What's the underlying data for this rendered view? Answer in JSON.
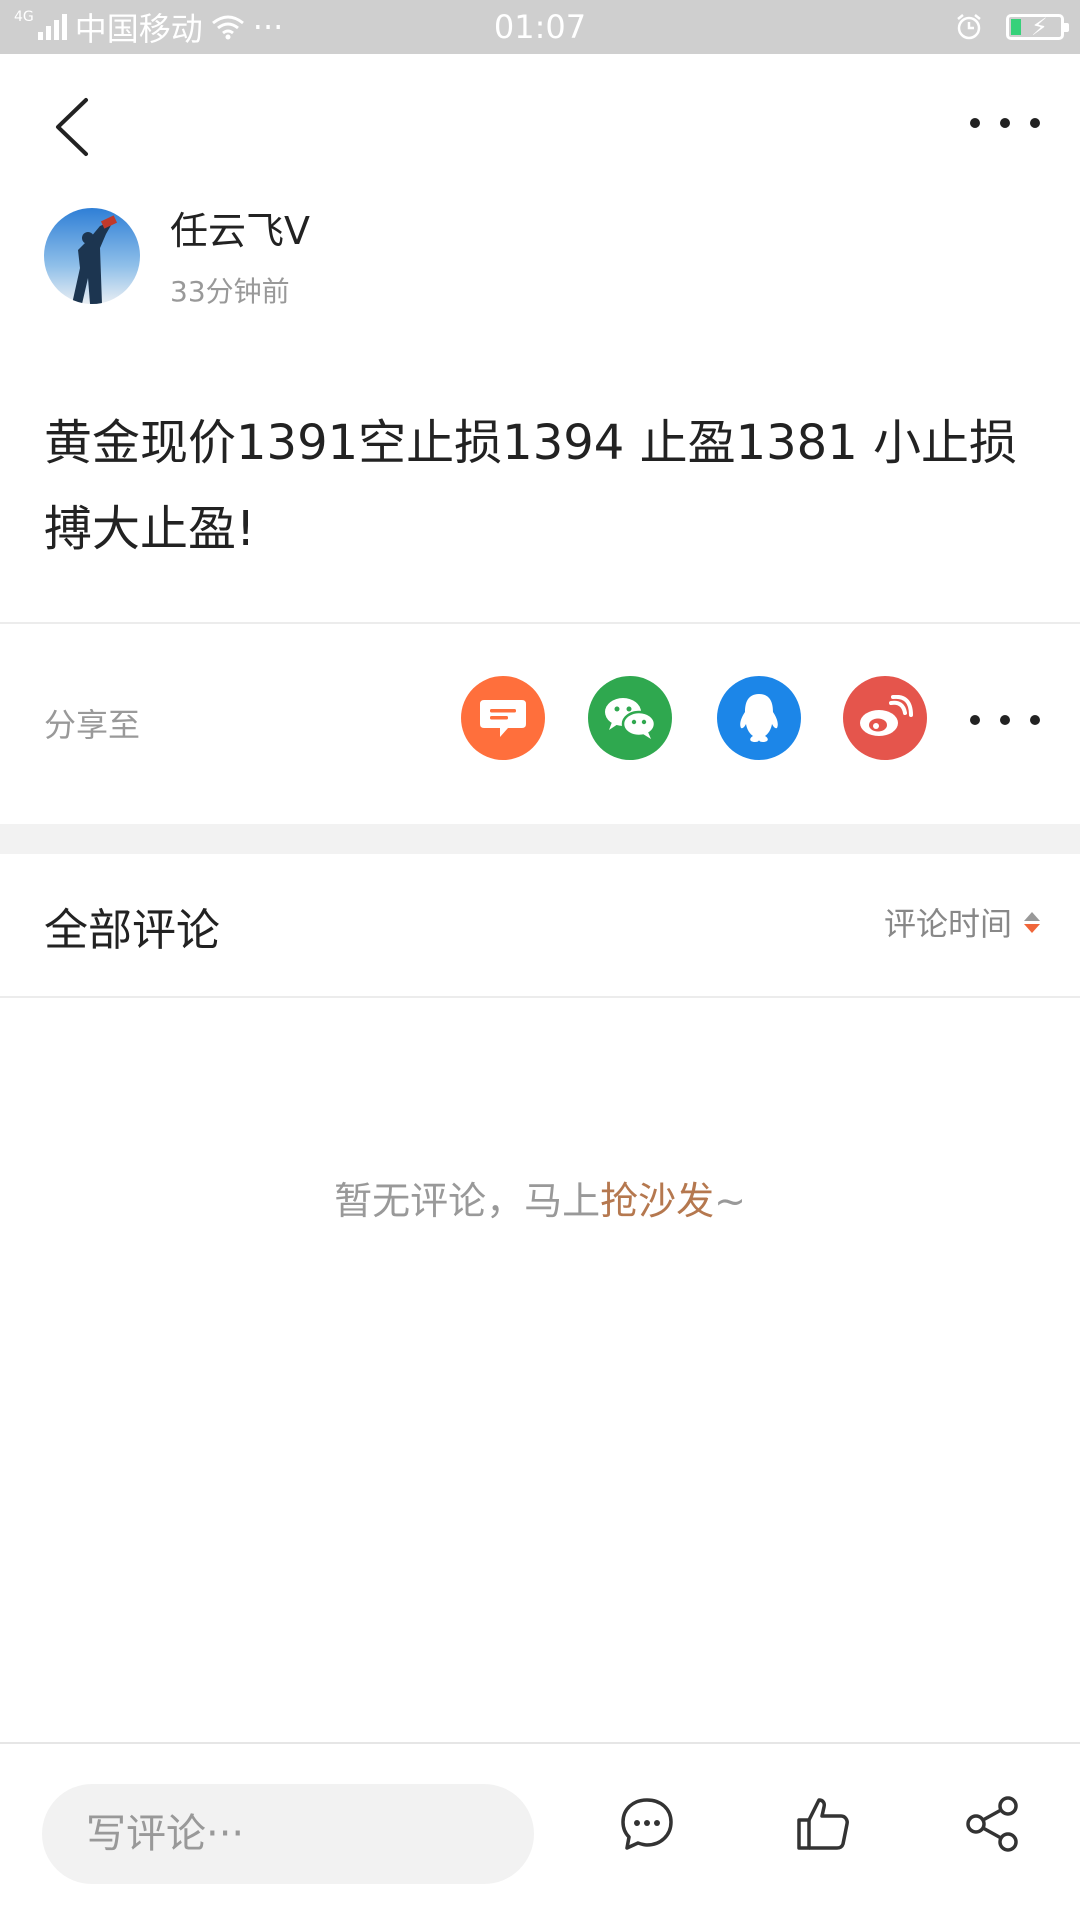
{
  "status_bar": {
    "network": "4G",
    "carrier": "中国移动",
    "more": "···",
    "time": "01:07"
  },
  "post": {
    "author": "任云飞V",
    "time_ago": "33分钟前",
    "content": "黄金现价1391空止损1394 止盈1381 小止损搏大止盈!"
  },
  "share": {
    "label": "分享至",
    "targets": [
      {
        "icon": "message-icon",
        "color": "#ff6f3c"
      },
      {
        "icon": "wechat-icon",
        "color": "#2fa84f"
      },
      {
        "icon": "qq-icon",
        "color": "#1c86e8"
      },
      {
        "icon": "weibo-icon",
        "color": "#e5554c"
      }
    ]
  },
  "comments": {
    "title": "全部评论",
    "sort_label": "评论时间",
    "empty_prefix": "暂无评论，马上",
    "empty_link": "抢沙发",
    "empty_suffix": "~"
  },
  "bottom_bar": {
    "input_placeholder": "写评论···"
  },
  "colors": {
    "accent": "#f0663a",
    "link": "#b5784f",
    "text_primary": "#222222",
    "text_secondary": "#999999"
  }
}
